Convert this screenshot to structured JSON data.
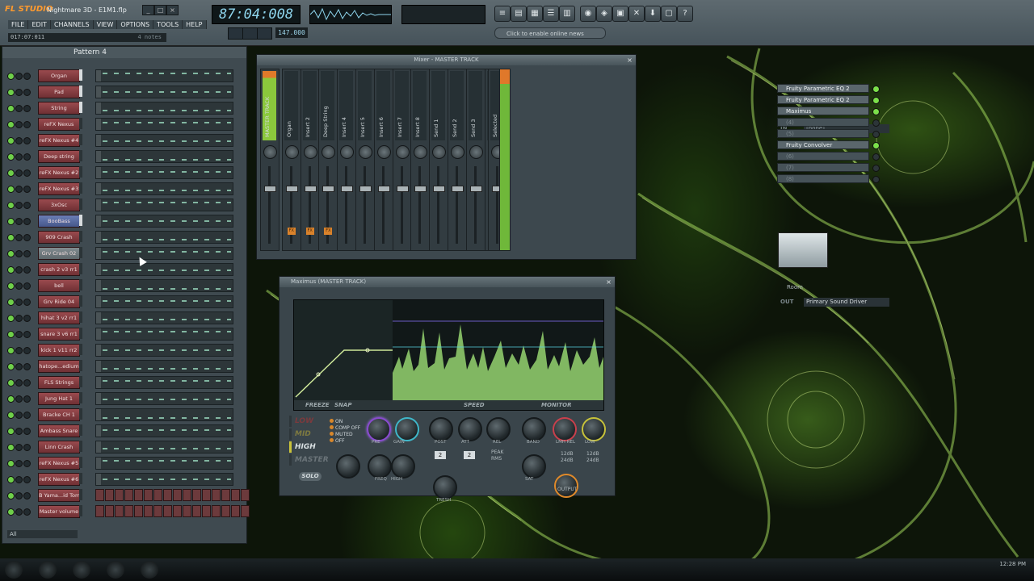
{
  "app": {
    "logo": "FL STUDIO",
    "title": "Nightmare 3D - E1M1.flp"
  },
  "menu": [
    "FILE",
    "EDIT",
    "CHANNELS",
    "VIEW",
    "OPTIONS",
    "TOOLS",
    "HELP"
  ],
  "hint_time": {
    "position": "017:07:011",
    "info": "4 notes"
  },
  "transport": {
    "time": "87:04:008",
    "tempo": "147.000",
    "online_hint": "Click to enable online news"
  },
  "channel_rack": {
    "pattern": "Pattern 4",
    "filter": "All",
    "channels": [
      {
        "name": "Organ",
        "style": "red",
        "selected": true
      },
      {
        "name": "Pad",
        "style": "red",
        "selected": true
      },
      {
        "name": "String",
        "style": "red",
        "selected": true
      },
      {
        "name": "reFX Nexus",
        "style": "red",
        "selected": false
      },
      {
        "name": "reFX Nexus #4",
        "style": "red",
        "selected": false
      },
      {
        "name": "Deep string",
        "style": "red",
        "selected": false
      },
      {
        "name": "reFX Nexus #2",
        "style": "red",
        "selected": false
      },
      {
        "name": "reFX Nexus #3",
        "style": "red",
        "selected": false
      },
      {
        "name": "3xOsc",
        "style": "red",
        "selected": false
      },
      {
        "name": "BooBass",
        "style": "blue",
        "selected": true
      },
      {
        "name": "909 Crash",
        "style": "red",
        "selected": false
      },
      {
        "name": "Grv Crash 02",
        "style": "gray",
        "selected": false
      },
      {
        "name": "crash 2 v3 rr1",
        "style": "red",
        "selected": false
      },
      {
        "name": "bell",
        "style": "red",
        "selected": false
      },
      {
        "name": "Grv Ride 04",
        "style": "red",
        "selected": false
      },
      {
        "name": "hihat 3 v2 rr1",
        "style": "red",
        "selected": false
      },
      {
        "name": "snare 3 v6 rr1",
        "style": "red",
        "selected": false
      },
      {
        "name": "kick 1 v11 rr2",
        "style": "red",
        "selected": false
      },
      {
        "name": "hatope...edium",
        "style": "red",
        "selected": false
      },
      {
        "name": "FLS Strings",
        "style": "red",
        "selected": false
      },
      {
        "name": "Jung Hat 1",
        "style": "red",
        "selected": false
      },
      {
        "name": "Bracke CH 1",
        "style": "red",
        "selected": false
      },
      {
        "name": "Ambass Snare",
        "style": "red",
        "selected": false
      },
      {
        "name": "Linn Crash",
        "style": "red",
        "selected": false
      },
      {
        "name": "reFX Nexus #5",
        "style": "red",
        "selected": false
      },
      {
        "name": "reFX Nexus #6",
        "style": "red",
        "selected": false
      },
      {
        "name": "B Yama...id Tom",
        "style": "red",
        "selected": false
      },
      {
        "name": "Master volume",
        "style": "red",
        "selected": false
      }
    ]
  },
  "mixer": {
    "title": "Mixer - MASTER TRACK",
    "tracks": [
      "MASTER TRACK",
      "Organ",
      "Insert 2",
      "Deep String",
      "Insert 4",
      "Insert 5",
      "Insert 6",
      "Insert 7",
      "Insert 8",
      "Send 1",
      "Send 2",
      "Send 3",
      "Send 4",
      "Selected"
    ],
    "input_label": "IN",
    "input_value": "(none)",
    "effects": [
      "Fruity Parametric EQ 2",
      "Fruity Parametric EQ 2",
      "Maximus",
      "(4)",
      "(5)",
      "Fruity Convolver",
      "(6)",
      "(7)",
      "(8)"
    ],
    "room_label": "Room",
    "output_label": "OUT",
    "output_value": "Primary Sound Driver"
  },
  "maximus": {
    "title": "Maximus (MASTER TRACK)",
    "graph_buttons": {
      "freeze": "FREEZE",
      "snap": "SNAP",
      "speed": "SPEED",
      "monitor": "MONITOR"
    },
    "bands": [
      "LOW",
      "MID",
      "HIGH",
      "MASTER"
    ],
    "band_options": [
      "ON",
      "COMP OFF",
      "MUTED",
      "OFF"
    ],
    "knob_labels": [
      "PRE",
      "GAIN",
      "POST",
      "ATT",
      "REL",
      "BAND",
      "LMH REL",
      "LOW",
      "FREQ",
      "HIGH",
      "TRESH",
      "SAT",
      "REL"
    ],
    "solo": "SOLO",
    "ratio_a": "2",
    "ratio_b": "2",
    "modes": [
      "PEAK",
      "RMS"
    ],
    "db_values": [
      "12dB",
      "12dB",
      "24dB",
      "24dB"
    ],
    "output": "OUTPUT"
  },
  "taskbar": {
    "clock": "12:28 PM"
  }
}
